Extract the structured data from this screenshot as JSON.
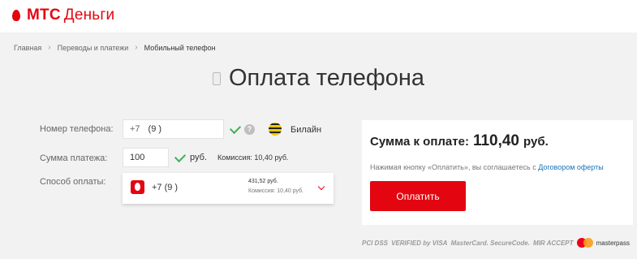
{
  "header": {
    "brand_main": "МТС",
    "brand_sub": "Деньги"
  },
  "breadcrumb": [
    "Главная",
    "Переводы и платежи",
    "Мобильный телефон"
  ],
  "page_title": "Оплата телефона",
  "form": {
    "phone_label": "Номер телефона:",
    "phone_prefix": "+7",
    "phone_value": "(9   )",
    "operator_name": "Билайн",
    "help_symbol": "?",
    "amount_label": "Сумма платежа:",
    "amount_value": "100",
    "amount_currency": "руб.",
    "commission_text": "Комиссия: 10,40 руб.",
    "method_label": "Способ оплаты:",
    "method_phone": "+7 (9     )",
    "method_balance": "431,52 руб.",
    "method_commission": "Комиссия: 10,40 руб."
  },
  "summary": {
    "label": "Сумма к оплате:",
    "value": "110,40",
    "currency": "руб.",
    "agreement_text": "Нажимая кнопку «Оплатить», вы соглашаетесь с",
    "agreement_link": "Договором оферты",
    "pay_button": "Оплатить"
  },
  "payment_logos": {
    "pci": "PCI DSS",
    "visa": "VERIFIED by VISA",
    "mastercard": "MasterCard. SecureCode.",
    "mir": "MIR ACCEPT",
    "masterpass": "masterpass"
  },
  "colors": {
    "accent": "#e30611",
    "link": "#1a73b7",
    "check": "#3fb454"
  }
}
